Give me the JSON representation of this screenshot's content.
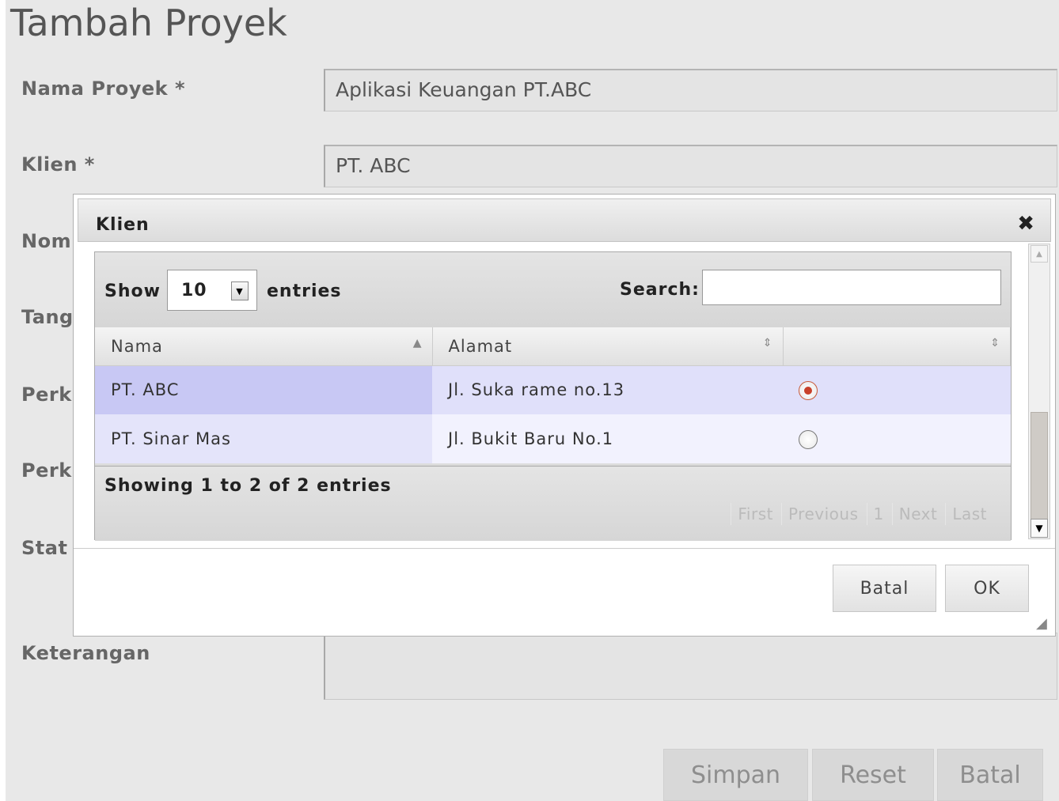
{
  "page": {
    "title": "Tambah Proyek",
    "labels": {
      "nama_proyek": "Nama Proyek *",
      "klien": "Klien *",
      "nomor_partial": "Nom",
      "tanggal_partial": "Tang",
      "perk1_partial": "Perk",
      "perk2_partial": "Perk",
      "status_partial": "Stat",
      "keterangan": "Keterangan"
    },
    "values": {
      "nama_proyek": "Aplikasi Keuangan PT.ABC",
      "klien": "PT. ABC"
    },
    "buttons": {
      "simpan": "Simpan",
      "reset": "Reset",
      "batal": "Batal"
    }
  },
  "dialog": {
    "title": "Klien",
    "close_glyph": "✖",
    "show_label": "Show",
    "page_length": "10",
    "entries_label": "entries",
    "search_label": "Search:",
    "search_value": "",
    "columns": [
      "Nama",
      "Alamat",
      ""
    ],
    "rows": [
      {
        "nama": "PT. ABC",
        "alamat": "Jl. Suka rame no.13",
        "selected": true
      },
      {
        "nama": "PT. Sinar Mas",
        "alamat": "Jl. Bukit Baru No.1",
        "selected": false
      }
    ],
    "info": "Showing 1 to 2 of 2 entries",
    "pager": {
      "first": "First",
      "previous": "Previous",
      "page": "1",
      "next": "Next",
      "last": "Last"
    },
    "buttons": {
      "batal": "Batal",
      "ok": "OK"
    }
  }
}
